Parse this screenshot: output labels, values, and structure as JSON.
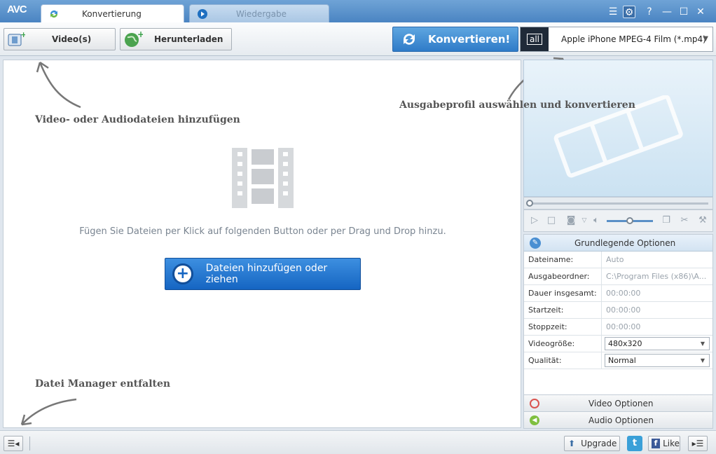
{
  "app": {
    "logo": "AVC"
  },
  "tabs": [
    {
      "label": "Konvertierung",
      "active": true
    },
    {
      "label": "Wiedergabe",
      "active": false
    }
  ],
  "window_controls": {
    "help": "?",
    "minimize": "—",
    "maximize": "☐",
    "close": "✕"
  },
  "toolbar": {
    "add_video_label": "Video(s)",
    "download_label": "Herunterladen",
    "convert_label": "Konvertieren!",
    "profile_icon_text": "all",
    "profile_value": "Apple iPhone MPEG-4 Film (*.mp4)"
  },
  "hints": {
    "add_files": "Video- oder Audiodateien hinzufügen",
    "output_profile": "Ausgabeprofil auswählen und konvertieren",
    "file_manager": "Datei Manager entfalten"
  },
  "main": {
    "drop_text": "Fügen Sie Dateien per Klick auf folgenden Button oder per Drag und Drop hinzu.",
    "add_button_label": "Dateien hinzufügen oder ziehen"
  },
  "options": {
    "header": "Grundlegende Optionen",
    "rows": [
      {
        "label": "Dateiname:",
        "value": "Auto"
      },
      {
        "label": "Ausgabeordner:",
        "value": "C:\\Program Files (x86)\\A..."
      },
      {
        "label": "Dauer insgesamt:",
        "value": "00:00:00"
      },
      {
        "label": "Startzeit:",
        "value": "00:00:00"
      },
      {
        "label": "Stoppzeit:",
        "value": "00:00:00"
      },
      {
        "label": "Videogröße:",
        "value": "480x320"
      },
      {
        "label": "Qualität:",
        "value": "Normal"
      }
    ],
    "video_options": "Video Optionen",
    "audio_options": "Audio Optionen"
  },
  "statusbar": {
    "upgrade_label": "Upgrade",
    "like_label": "Like"
  },
  "colors": {
    "accent": "#2f7bc8",
    "titlebar": "#4a84c2"
  }
}
